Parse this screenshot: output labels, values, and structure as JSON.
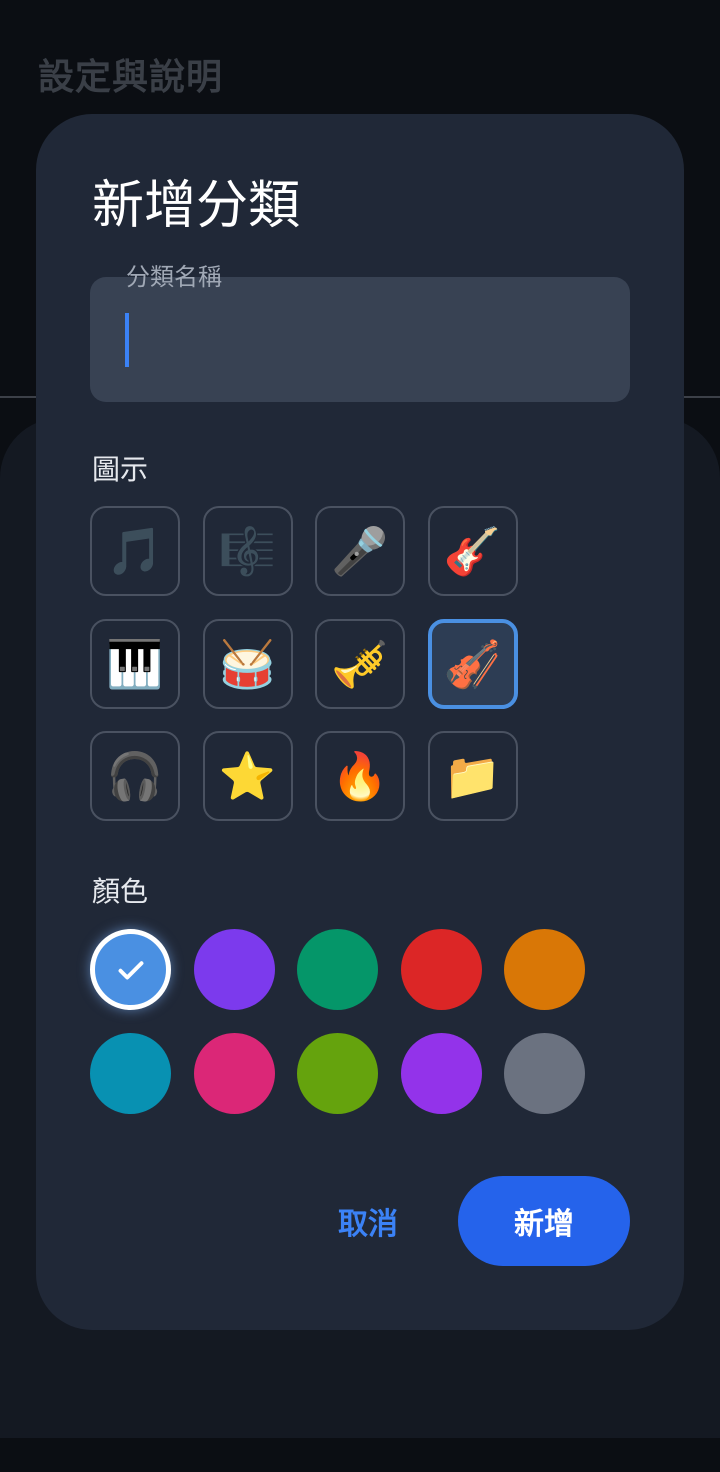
{
  "background": {
    "title": "設定與說明"
  },
  "dialog": {
    "title": "新增分類",
    "name_field": {
      "label": "分類名稱",
      "value": ""
    },
    "icon_section_label": "圖示",
    "icons": [
      {
        "name": "musical-note-icon",
        "glyph": "🎵"
      },
      {
        "name": "musical-score-icon",
        "glyph": "🎼"
      },
      {
        "name": "microphone-icon",
        "glyph": "🎤"
      },
      {
        "name": "guitar-icon",
        "glyph": "🎸"
      },
      {
        "name": "piano-keys-icon",
        "glyph": "🎹"
      },
      {
        "name": "drum-icon",
        "glyph": "🥁"
      },
      {
        "name": "trumpet-icon",
        "glyph": "🎺"
      },
      {
        "name": "violin-icon",
        "glyph": "🎻",
        "selected": true
      },
      {
        "name": "headphones-icon",
        "glyph": "🎧"
      },
      {
        "name": "star-icon",
        "glyph": "⭐"
      },
      {
        "name": "fire-icon",
        "glyph": "🔥"
      },
      {
        "name": "folder-icon",
        "glyph": "📁"
      }
    ],
    "color_section_label": "顏色",
    "colors": [
      {
        "hex": "#4a90e2",
        "selected": true
      },
      {
        "hex": "#7c3aed"
      },
      {
        "hex": "#059669"
      },
      {
        "hex": "#dc2626"
      },
      {
        "hex": "#d97706"
      },
      {
        "hex": "#0891b2"
      },
      {
        "hex": "#db2777"
      },
      {
        "hex": "#65a30d"
      },
      {
        "hex": "#9333ea"
      },
      {
        "hex": "#6b7280"
      }
    ],
    "cancel_label": "取消",
    "add_label": "新增"
  }
}
